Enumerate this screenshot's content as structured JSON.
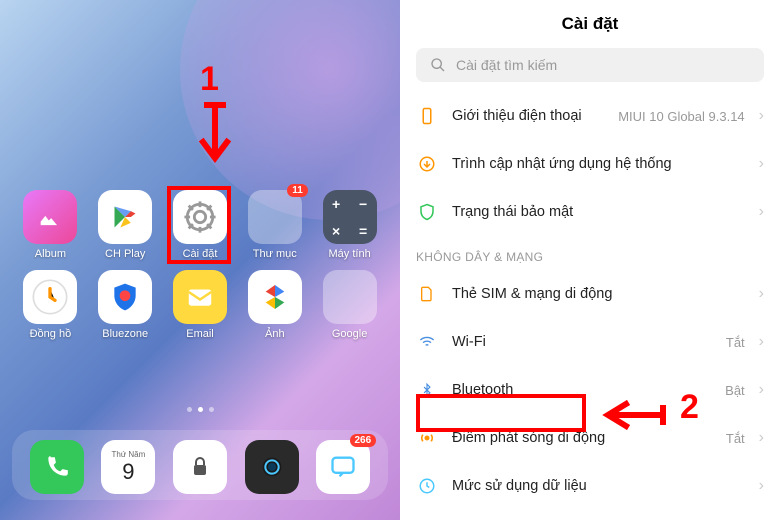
{
  "home": {
    "apps": [
      {
        "label": "Album"
      },
      {
        "label": "CH Play"
      },
      {
        "label": "Cài đặt"
      },
      {
        "label": "Thư mục",
        "badge": "11"
      },
      {
        "label": "Máy tính"
      },
      {
        "label": "Đồng hồ"
      },
      {
        "label": "Bluezone"
      },
      {
        "label": "Email"
      },
      {
        "label": "Ảnh"
      },
      {
        "label": "Google"
      }
    ],
    "dock_date_day": "Thứ Năm",
    "dock_date_num": "9",
    "dock_badge": "266"
  },
  "annotations": {
    "step1": "1",
    "step2": "2"
  },
  "settings": {
    "title": "Cài đặt",
    "search_placeholder": "Cài đặt tìm kiếm",
    "about_label": "Giới thiệu điện thoại",
    "about_value": "MIUI 10 Global 9.3.14",
    "update_label": "Trình cập nhật ứng dụng hệ thống",
    "security_label": "Trạng thái bảo mật",
    "wireless_header": "KHÔNG DÂY & MẠNG",
    "sim_label": "Thẻ SIM & mạng di động",
    "wifi_label": "Wi-Fi",
    "wifi_value": "Tắt",
    "bluetooth_label": "Bluetooth",
    "bluetooth_value": "Bật",
    "hotspot_label": "Điểm phát sóng di động",
    "hotspot_value": "Tắt",
    "data_label": "Mức sử dụng dữ liệu"
  }
}
